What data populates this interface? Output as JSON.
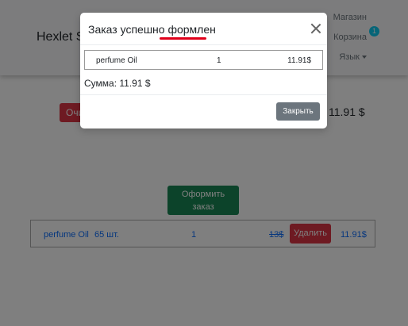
{
  "header": {
    "brand": "Hexlet Store",
    "nav": {
      "shop": "Магазин",
      "cart": "Корзина",
      "cart_count": "1",
      "language": "Язык"
    }
  },
  "cart": {
    "clear_label": "Очистить",
    "total_text": "11.91 $",
    "checkout_line1": "Оформить",
    "checkout_line2": "заказ",
    "row": {
      "name": "perfume Oil",
      "stock": "65 шт.",
      "qty": "1",
      "old_price": "13$",
      "delete_label": "Удалить",
      "price": "11.91$"
    }
  },
  "modal": {
    "title": "Заказ успешно формлен",
    "item": {
      "name": "perfume Oil",
      "qty": "1",
      "price": "11.91$"
    },
    "sum": "Сумма: 11.91 $",
    "close_label": "Закрыть"
  },
  "colors": {
    "danger": "#dc3545",
    "success": "#198754",
    "secondary": "#6c757d",
    "info": "#0dcaf0",
    "primary": "#0d6efd"
  }
}
